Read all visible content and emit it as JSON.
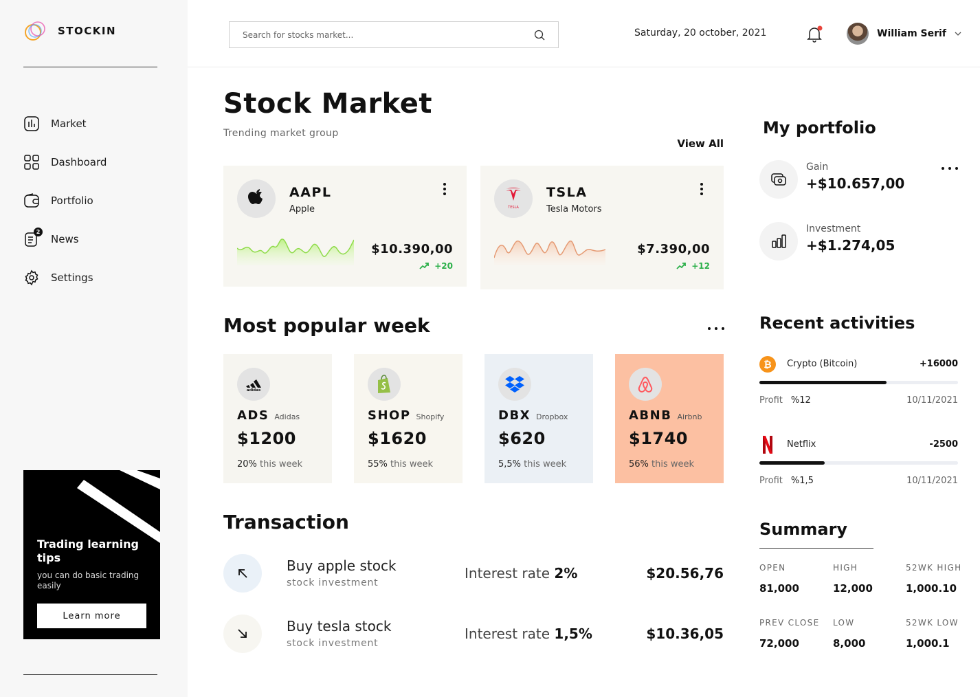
{
  "app": {
    "name": "STOCKIN"
  },
  "sidebar": {
    "items": [
      {
        "label": "Market",
        "icon": "bar-chart-icon"
      },
      {
        "label": "Dashboard",
        "icon": "grid-icon"
      },
      {
        "label": "Portfolio",
        "icon": "wallet-icon"
      },
      {
        "label": "News",
        "icon": "news-icon",
        "badge": "2"
      },
      {
        "label": "Settings",
        "icon": "gear-icon"
      }
    ],
    "promo": {
      "title": "Trading learning tips",
      "subtitle": "you can do basic trading easily",
      "button": "Learn more"
    }
  },
  "header": {
    "search_placeholder": "Search for stocks market...",
    "date": "Saturday, 20 october, 2021",
    "user_name": "William Serif",
    "notification_color": "#e8453c"
  },
  "main": {
    "title": "Stock Market",
    "subtitle": "Trending market group",
    "view_all": "View All",
    "trending": [
      {
        "ticker": "AAPL",
        "name": "Apple",
        "price": "$10.390,00",
        "change": "+20",
        "spark_color": "#9be05b"
      },
      {
        "ticker": "TSLA",
        "name": "Tesla Motors",
        "price": "$7.390,00",
        "change": "+12",
        "spark_color": "#e8a07a"
      }
    ],
    "popular_title": "Most popular week",
    "popular": [
      {
        "ticker": "ADS",
        "name": "Adidas",
        "price": "$1200",
        "pct": "20%",
        "suffix": "this week",
        "bg": "#f6f5f0"
      },
      {
        "ticker": "SHOP",
        "name": "Shopify",
        "price": "$1620",
        "pct": "55%",
        "suffix": "this week",
        "bg": "#f8f6ef"
      },
      {
        "ticker": "DBX",
        "name": "Dropbox",
        "price": "$620",
        "pct": "5,5%",
        "suffix": "this week",
        "bg": "#ebf0f5"
      },
      {
        "ticker": "ABNB",
        "name": "Airbnb",
        "price": "$1740",
        "pct": "56%",
        "suffix": "this week",
        "bg": "#fcc0a2"
      }
    ],
    "transaction_title": "Transaction",
    "transactions": [
      {
        "title": "Buy apple stock",
        "sub": "stock investment",
        "rate_label": "Interest rate",
        "rate": "2%",
        "amount": "$20.56,76"
      },
      {
        "title": "Buy tesla stock",
        "sub": "stock investment",
        "rate_label": "Interest rate",
        "rate": "1,5%",
        "amount": "$10.36,05"
      }
    ]
  },
  "portfolio": {
    "title": "My portfolio",
    "items": [
      {
        "label": "Gain",
        "value": "+$10.657,00"
      },
      {
        "label": "Investment",
        "value": "+$1.274,05"
      }
    ]
  },
  "activities": {
    "title": "Recent activities",
    "items": [
      {
        "name": "Crypto (Bitcoin)",
        "amount": "+16000",
        "progress": 0.64,
        "profit_label": "Profit",
        "profit": "%12",
        "date": "10/11/2021"
      },
      {
        "name": "Netflix",
        "amount": "-2500",
        "progress": 0.33,
        "profit_label": "Profit",
        "profit": "%1,5",
        "date": "10/11/2021"
      }
    ]
  },
  "summary": {
    "title": "Summary",
    "cells": [
      {
        "label": "OPEN",
        "value": "81,000"
      },
      {
        "label": "HIGH",
        "value": "12,000"
      },
      {
        "label": "52WK HIGH",
        "value": "1,000.10"
      },
      {
        "label": "PREV CLOSE",
        "value": "72,000"
      },
      {
        "label": "LOW",
        "value": "8,000"
      },
      {
        "label": "52WK LOW",
        "value": "1,000.1"
      }
    ]
  }
}
